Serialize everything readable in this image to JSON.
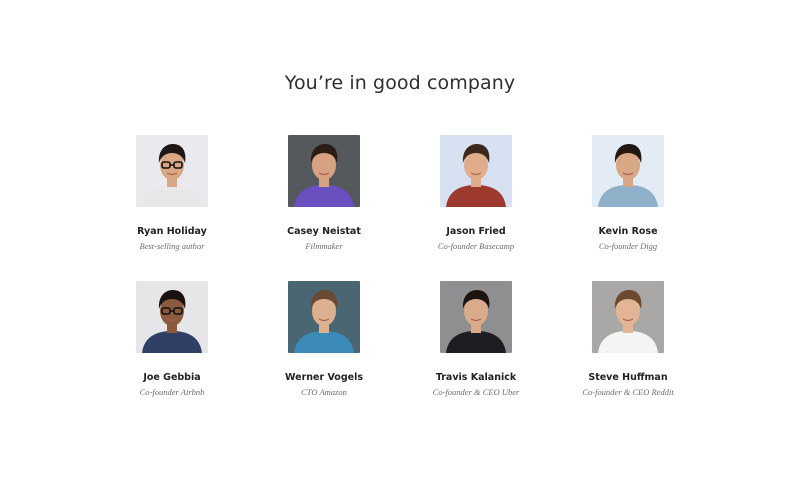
{
  "section": {
    "title": "You’re in good company"
  },
  "people": [
    {
      "name": "Ryan Holiday",
      "role": "Best-selling author",
      "bg": "#e9e9ee",
      "hair": "#1e1715",
      "skin": "#d9a784",
      "shirt": "#e8e8e8",
      "glasses": true,
      "icon": "person-portrait-icon"
    },
    {
      "name": "Casey Neistat",
      "role": "Filmmaker",
      "bg": "#55585c",
      "hair": "#2b1d16",
      "skin": "#d6a282",
      "shirt": "#6a4fc0",
      "glasses": false,
      "icon": "person-portrait-icon"
    },
    {
      "name": "Jason Fried",
      "role": "Co-founder Basecamp",
      "bg": "#d7e1f2",
      "hair": "#3a281d",
      "skin": "#e0ad8c",
      "shirt": "#9d3a2e",
      "glasses": false,
      "icon": "person-portrait-icon"
    },
    {
      "name": "Kevin Rose",
      "role": "Co-founder Digg",
      "bg": "#e3ecf4",
      "hair": "#231712",
      "skin": "#d8a786",
      "shirt": "#8fb0c9",
      "glasses": false,
      "icon": "person-portrait-icon"
    },
    {
      "name": "Joe Gebbia",
      "role": "Co-founder Airbnb",
      "bg": "#e6e6e8",
      "hair": "#1a1210",
      "skin": "#8a5a3f",
      "shirt": "#2f3f66",
      "glasses": true,
      "icon": "person-portrait-icon"
    },
    {
      "name": "Werner Vogels",
      "role": "CTO Amazon",
      "bg": "#4b6673",
      "hair": "#6a4a34",
      "skin": "#ddb08f",
      "shirt": "#3b8ab8",
      "glasses": false,
      "icon": "person-portrait-icon"
    },
    {
      "name": "Travis Kalanick",
      "role": "Co-founder & CEO Uber",
      "bg": "#8f8f92",
      "hair": "#1c1410",
      "skin": "#d9ab8b",
      "shirt": "#1e1e22",
      "glasses": false,
      "icon": "person-portrait-icon"
    },
    {
      "name": "Steve Huffman",
      "role": "Co-founder & CEO Reddit",
      "bg": "#a9a8a6",
      "hair": "#6b4a30",
      "skin": "#e1b595",
      "shirt": "#f4f4f4",
      "glasses": false,
      "icon": "person-portrait-icon"
    }
  ]
}
